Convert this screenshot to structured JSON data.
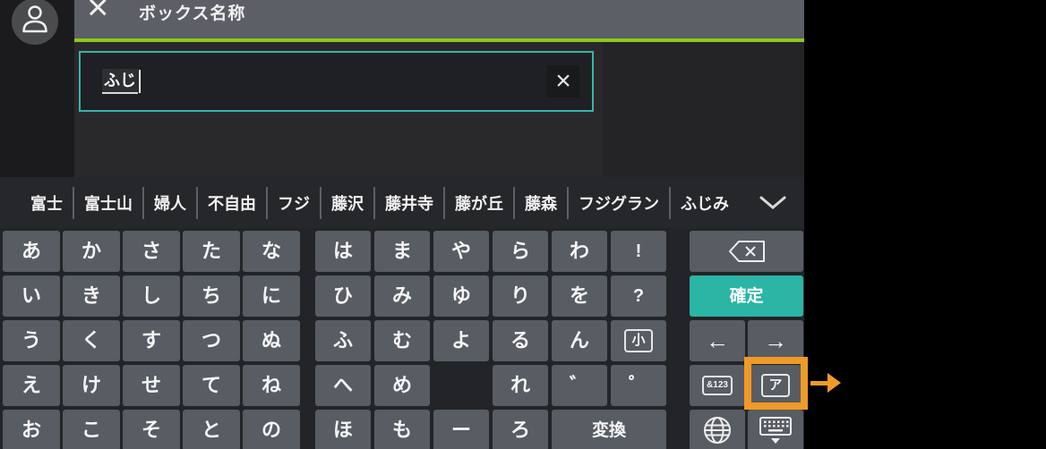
{
  "header": {
    "title": "ボックス名称",
    "close_glyph": "×"
  },
  "input": {
    "value": "ふじ",
    "clear_glyph": "×"
  },
  "candidates": {
    "items": [
      "富士",
      "富士山",
      "婦人",
      "不自由",
      "フジ",
      "藤沢",
      "藤井寺",
      "藤が丘",
      "藤森",
      "フジグラン",
      "ふじみ"
    ],
    "expand_icon": "chevron-down-icon"
  },
  "keyboard": {
    "left_rows": [
      [
        "あ",
        "か",
        "さ",
        "た",
        "な"
      ],
      [
        "い",
        "き",
        "し",
        "ち",
        "に"
      ],
      [
        "う",
        "く",
        "す",
        "つ",
        "ぬ"
      ],
      [
        "え",
        "け",
        "せ",
        "て",
        "ね"
      ],
      [
        "お",
        "こ",
        "そ",
        "と",
        "の"
      ]
    ],
    "middle_keys": [
      {
        "row": 0,
        "col": 0,
        "label": "は"
      },
      {
        "row": 0,
        "col": 1,
        "label": "ま"
      },
      {
        "row": 0,
        "col": 2,
        "label": "や"
      },
      {
        "row": 0,
        "col": 3,
        "label": "ら"
      },
      {
        "row": 0,
        "col": 4,
        "label": "わ"
      },
      {
        "row": 0,
        "col": 5,
        "label": "!",
        "small": true
      },
      {
        "row": 1,
        "col": 0,
        "label": "ひ"
      },
      {
        "row": 1,
        "col": 1,
        "label": "み"
      },
      {
        "row": 1,
        "col": 2,
        "label": "ゆ"
      },
      {
        "row": 1,
        "col": 3,
        "label": "り"
      },
      {
        "row": 1,
        "col": 4,
        "label": "を"
      },
      {
        "row": 1,
        "col": 5,
        "label": "?",
        "small": true
      },
      {
        "row": 2,
        "col": 0,
        "label": "ふ"
      },
      {
        "row": 2,
        "col": 1,
        "label": "む"
      },
      {
        "row": 2,
        "col": 2,
        "label": "よ"
      },
      {
        "row": 2,
        "col": 3,
        "label": "る"
      },
      {
        "row": 2,
        "col": 4,
        "label": "ん"
      },
      {
        "row": 2,
        "col": 5,
        "label": "小",
        "boxed": true,
        "name": "key-small-kana"
      },
      {
        "row": 3,
        "col": 0,
        "label": "へ"
      },
      {
        "row": 3,
        "col": 1,
        "label": "め"
      },
      {
        "row": 3,
        "col": 3,
        "label": "れ"
      },
      {
        "row": 3,
        "col": 4,
        "label": "゛",
        "name": "key-dakuten"
      },
      {
        "row": 3,
        "col": 5,
        "label": "゜",
        "name": "key-handakuten"
      },
      {
        "row": 4,
        "col": 0,
        "label": "ほ"
      },
      {
        "row": 4,
        "col": 1,
        "label": "も"
      },
      {
        "row": 4,
        "col": 2,
        "label": "ー"
      },
      {
        "row": 4,
        "col": 3,
        "label": "ろ"
      },
      {
        "row": 4,
        "col": 4,
        "label": "変換",
        "span": 2,
        "mid": true,
        "name": "key-convert"
      }
    ],
    "right_keys": [
      {
        "row": 0,
        "span": "full",
        "icon": "backspace-icon",
        "name": "key-backspace"
      },
      {
        "row": 1,
        "span": "full",
        "label": "確定",
        "accent": true,
        "name": "key-confirm"
      },
      {
        "row": 2,
        "col": 0,
        "label": "←",
        "arrow": true,
        "name": "key-cursor-left"
      },
      {
        "row": 2,
        "col": 1,
        "label": "→",
        "arrow": true,
        "name": "key-cursor-right"
      },
      {
        "row": 3,
        "col": 0,
        "label": "&123",
        "boxed": true,
        "name": "key-symbols-numbers"
      },
      {
        "row": 3,
        "col": 1,
        "label": "ア",
        "boxed": true,
        "name": "key-katakana"
      },
      {
        "row": 4,
        "col": 0,
        "icon": "globe-icon",
        "name": "key-input-language"
      },
      {
        "row": 4,
        "col": 1,
        "icon": "keyboard-hide-icon",
        "name": "key-hide-keyboard"
      }
    ]
  },
  "annotation": {
    "type": "highlight-box-with-arrow",
    "target": "key-katakana",
    "color": "#ef9a28"
  },
  "colors": {
    "accent_teal": "#2ab5a5",
    "lime_green_line": "#8dc818",
    "input_border_teal": "#3ab3ac",
    "highlight_orange": "#ef9a28",
    "key_gray": "#585c63",
    "header_gray": "#5c5f66"
  }
}
